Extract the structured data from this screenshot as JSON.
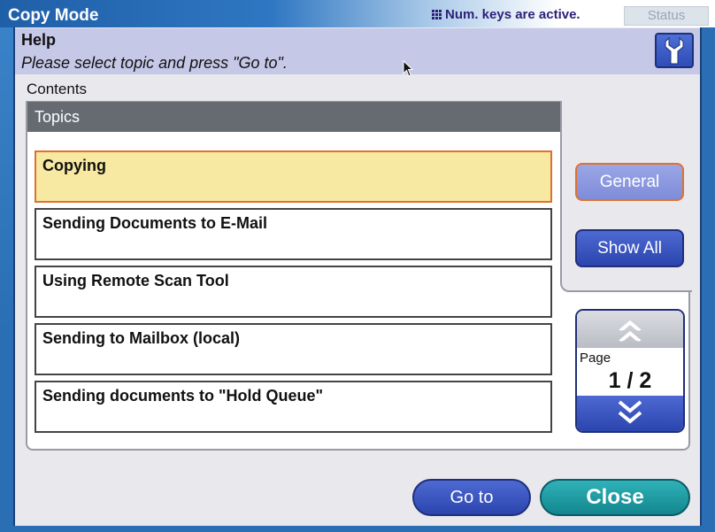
{
  "window": {
    "title": "Copy Mode",
    "num_keys_status": "Num. keys are active.",
    "status_button": "Status"
  },
  "help": {
    "title": "Help",
    "subtitle": "Please select topic and press \"Go to\".",
    "wrench_icon": "wrench-icon"
  },
  "contents": {
    "label": "Contents",
    "header": "Topics",
    "topics": [
      {
        "label": "Copying",
        "selected": true
      },
      {
        "label": "Sending Documents to E-Mail",
        "selected": false
      },
      {
        "label": "Using Remote Scan Tool",
        "selected": false
      },
      {
        "label": "Sending to Mailbox (local)",
        "selected": false
      },
      {
        "label": "Sending documents to \"Hold Queue\"",
        "selected": false
      }
    ]
  },
  "side_buttons": {
    "general": "General",
    "show_all": "Show All"
  },
  "pager": {
    "label": "Page",
    "value": "1 / 2"
  },
  "actions": {
    "go_to": "Go to",
    "close": "Close"
  },
  "colors": {
    "selected_fill": "#f7e8a2",
    "selected_border": "#e07030",
    "button_blue": "#2c45ae",
    "close_teal": "#13868e",
    "help_header": "#c5c8e6"
  }
}
